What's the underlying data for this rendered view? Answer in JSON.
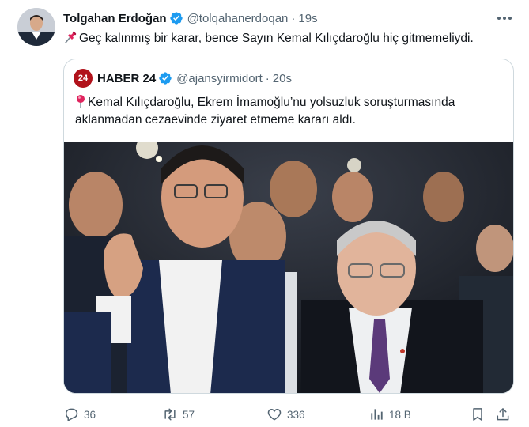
{
  "tweet": {
    "author_name": "Tolgahan Erdoğan",
    "handle": "@tolqahanerdoqan",
    "separator": "·",
    "time": "19s",
    "text": "Geç kalınmış bir karar, bence Sayın Kemal Kılıçdaroğlu hiç gitmemeliydi."
  },
  "quote": {
    "avatar_text": "24",
    "author_name": "HABER 24",
    "handle": "@ajansyirmidort",
    "separator": "·",
    "time": "20s",
    "text_line1": "Kemal Kılıçdaroğlu, Ekrem İmamoğlu’nu yolsuzluk soruşturmasında",
    "text_line2": "aklanmadan cezaevinde ziyaret etmeme kararı aldı."
  },
  "actions": {
    "reply_count": "36",
    "retweet_count": "57",
    "like_count": "336",
    "views_count": "18 B"
  },
  "colors": {
    "verified_blue": "#1d9bf0",
    "muted_text": "#536471",
    "border": "#cfd9de",
    "haber24_red": "#b1121b"
  }
}
